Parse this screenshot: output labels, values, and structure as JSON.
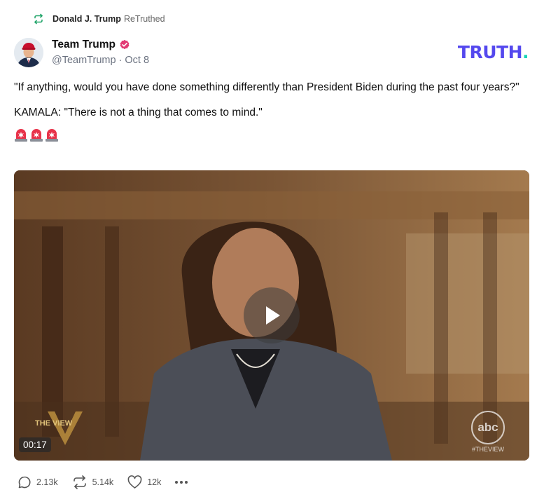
{
  "retruth": {
    "name": "Donald J. Trump",
    "action": "ReTruthed"
  },
  "author": {
    "display_name": "Team Trump",
    "handle": "@TeamTrump",
    "separator": "·",
    "date": "Oct 8",
    "verified": true
  },
  "brand": {
    "logo_text": "TRUTH",
    "logo_dot": ".",
    "primary_color": "#5448ee",
    "accent_color": "#17d5b7"
  },
  "post": {
    "paragraphs": [
      "\"If anything, would you have done something differently than President Biden during the past four years?\"",
      "KAMALA: \"There is not a thing that comes to mind.\""
    ],
    "emojis": [
      "police-light-emoji",
      "police-light-emoji",
      "police-light-emoji"
    ]
  },
  "video": {
    "duration": "00:17",
    "show_logo_text": "THE VIEW",
    "network_logo_text": "abc",
    "network_tag": "#THEVIEW"
  },
  "actions": {
    "replies": "2.13k",
    "retruths": "5.14k",
    "likes": "12k"
  }
}
